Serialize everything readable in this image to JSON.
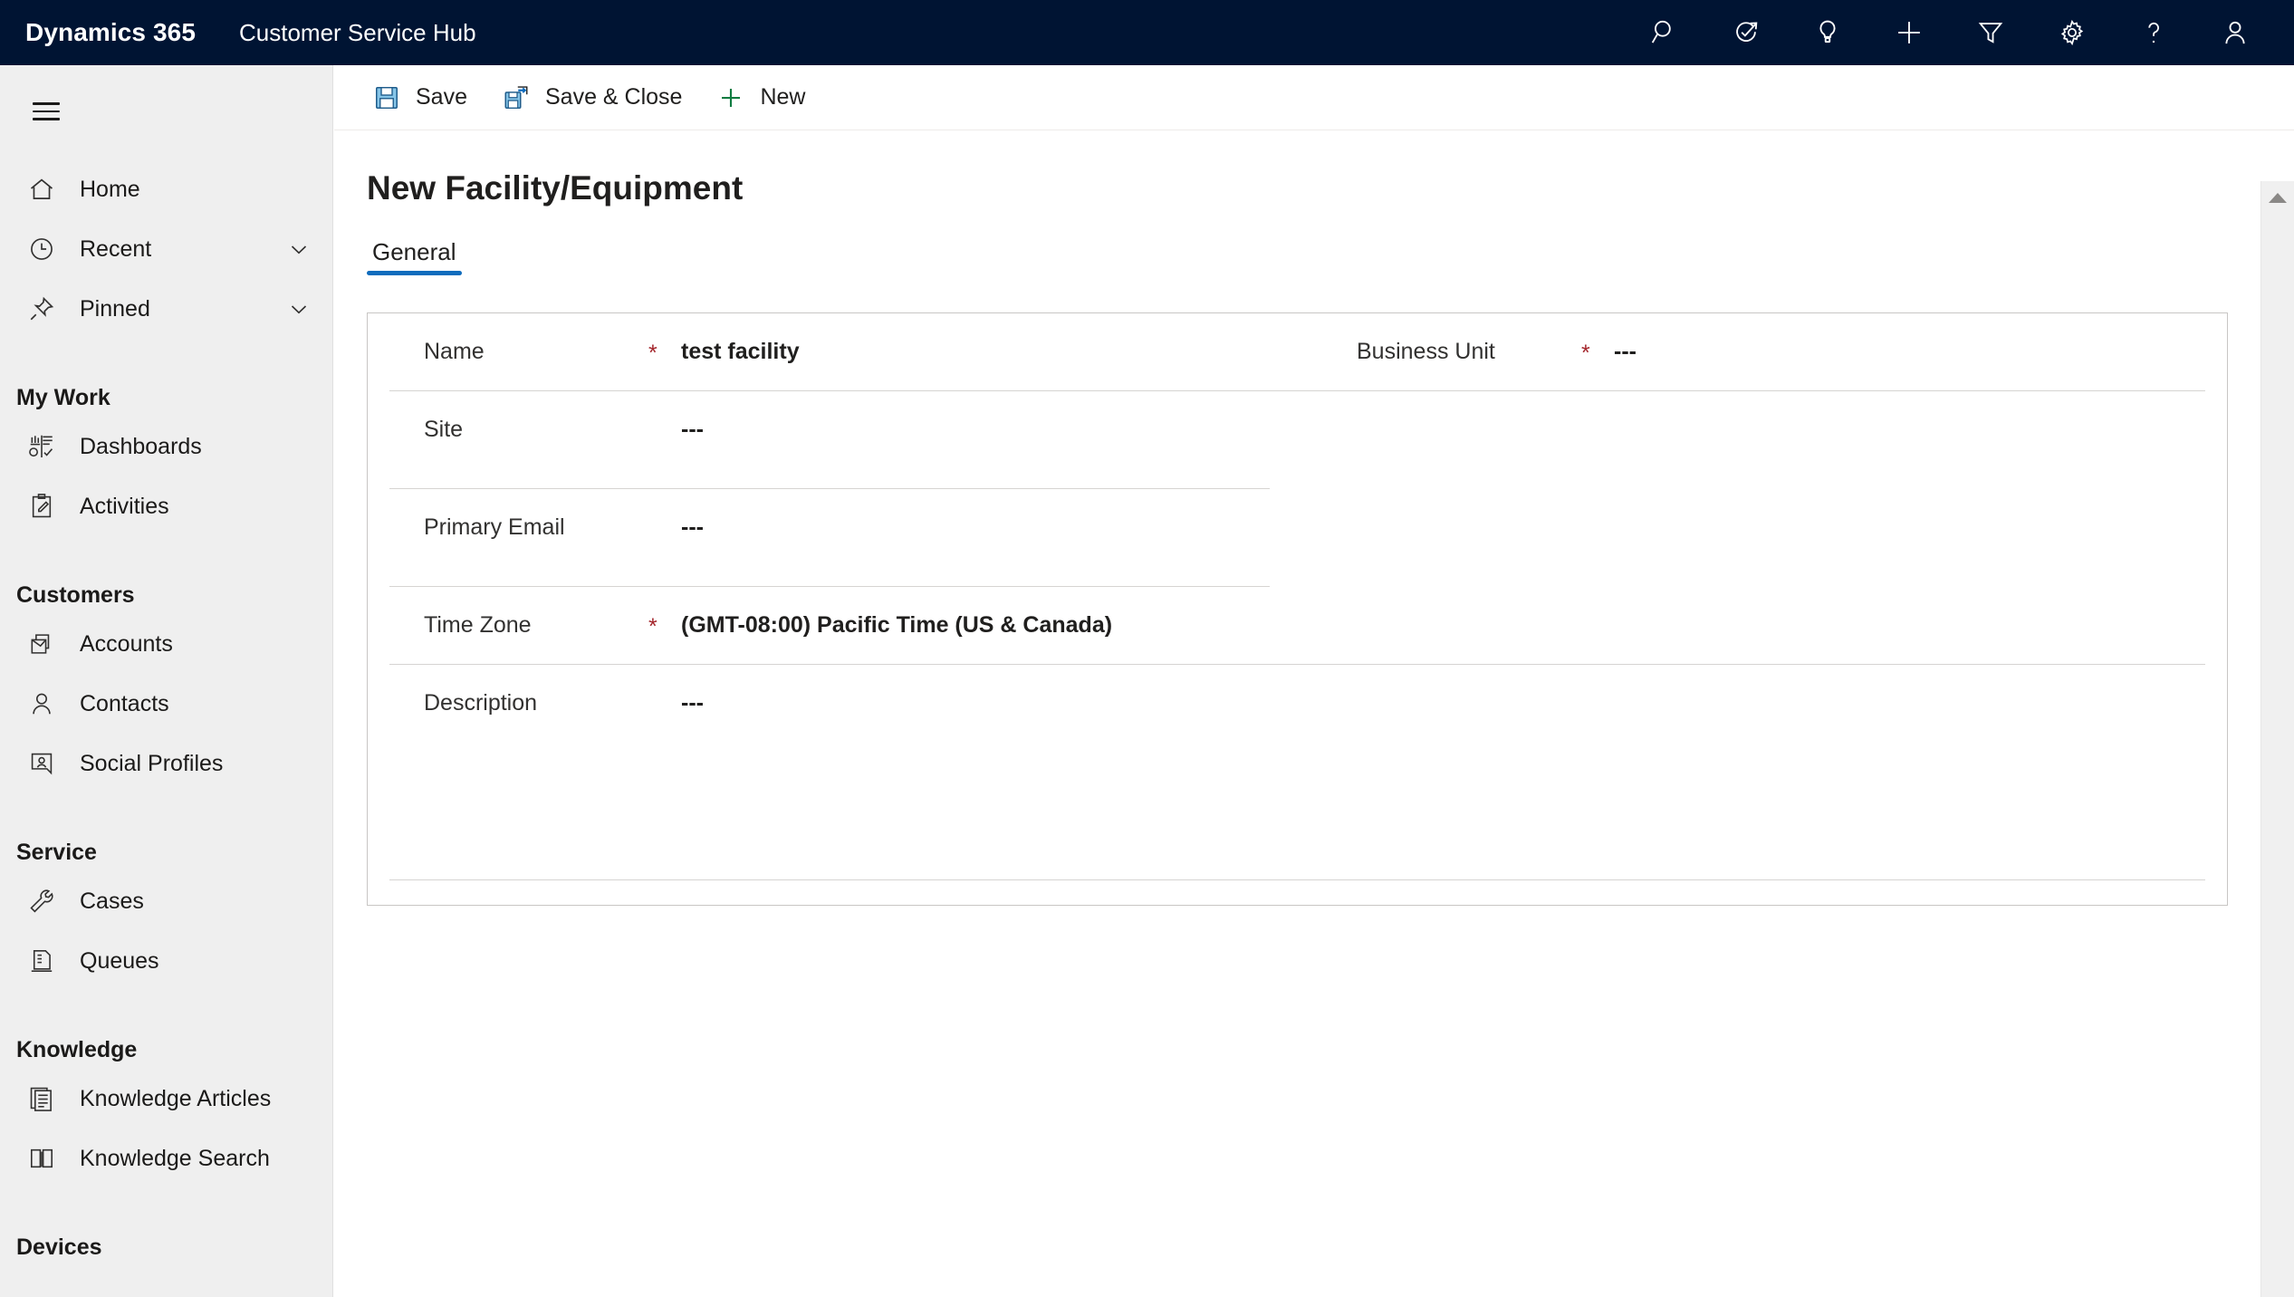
{
  "app_bar": {
    "brand": "Dynamics 365",
    "app_name": "Customer Service Hub",
    "background_color": "#001433",
    "icons": [
      {
        "name": "search-icon",
        "label": "Search"
      },
      {
        "name": "diagnostics-icon",
        "label": "Diagnostics"
      },
      {
        "name": "lightbulb-icon",
        "label": "Insights"
      },
      {
        "name": "plus-icon",
        "label": "Quick Create"
      },
      {
        "name": "filter-icon",
        "label": "Filter"
      },
      {
        "name": "gear-icon",
        "label": "Settings"
      },
      {
        "name": "help-icon",
        "label": "Help"
      },
      {
        "name": "user-avatar-icon",
        "label": "Account Manager"
      }
    ]
  },
  "sidebar": {
    "hamburger_label": "Site Map",
    "top_items": [
      {
        "label": "Home",
        "icon": "home-icon",
        "expandable": false
      },
      {
        "label": "Recent",
        "icon": "clock-icon",
        "expandable": true
      },
      {
        "label": "Pinned",
        "icon": "pin-icon",
        "expandable": true
      }
    ],
    "groups": [
      {
        "title": "My Work",
        "items": [
          {
            "label": "Dashboards",
            "icon": "dashboard-icon"
          },
          {
            "label": "Activities",
            "icon": "activities-icon"
          }
        ]
      },
      {
        "title": "Customers",
        "items": [
          {
            "label": "Accounts",
            "icon": "accounts-icon"
          },
          {
            "label": "Contacts",
            "icon": "contacts-icon"
          },
          {
            "label": "Social Profiles",
            "icon": "social-profile-icon"
          }
        ]
      },
      {
        "title": "Service",
        "items": [
          {
            "label": "Cases",
            "icon": "wrench-icon"
          },
          {
            "label": "Queues",
            "icon": "queues-icon"
          }
        ]
      },
      {
        "title": "Knowledge",
        "items": [
          {
            "label": "Knowledge Articles",
            "icon": "knowledge-article-icon"
          },
          {
            "label": "Knowledge Search",
            "icon": "book-icon"
          }
        ]
      },
      {
        "title": "Devices",
        "items": []
      }
    ]
  },
  "command_bar": {
    "buttons": [
      {
        "label": "Save",
        "icon": "save-icon"
      },
      {
        "label": "Save & Close",
        "icon": "save-and-close-icon"
      },
      {
        "label": "New",
        "icon": "new-plus-icon"
      }
    ]
  },
  "main": {
    "title": "New Facility/Equipment",
    "tabs": [
      {
        "label": "General",
        "active": true
      }
    ],
    "accent_color": "#0f6cbd",
    "required_marker": "*",
    "required_color": "#a4262c",
    "empty_value": "---",
    "fields_left": [
      {
        "label": "Name",
        "required": true,
        "value": "test facility"
      },
      {
        "label": "Site",
        "required": false,
        "value": "---"
      },
      {
        "label": "Primary Email",
        "required": false,
        "value": "---"
      },
      {
        "label": "Time Zone",
        "required": true,
        "value": "(GMT-08:00) Pacific Time (US & Canada)"
      },
      {
        "label": "Description",
        "required": false,
        "value": "---"
      }
    ],
    "fields_right": [
      {
        "label": "Business Unit",
        "required": true,
        "value": "---"
      }
    ]
  },
  "scrollbar": {
    "up_arrow_name": "scroll-up-arrow"
  }
}
